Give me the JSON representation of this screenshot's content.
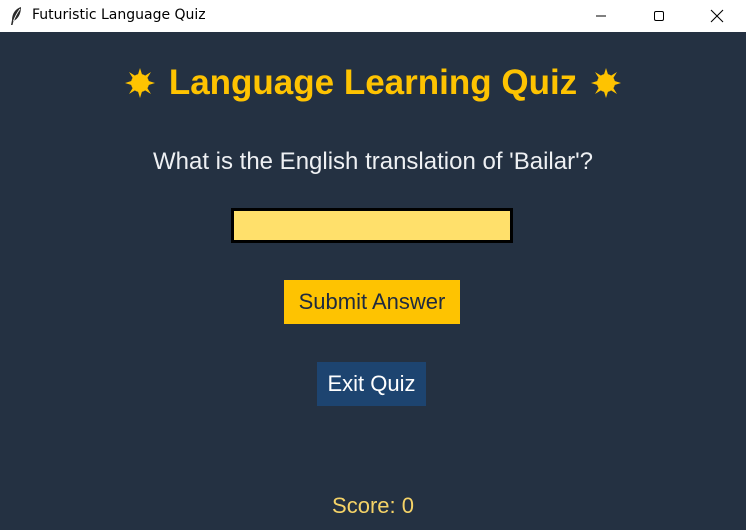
{
  "window": {
    "title": "Futuristic Language Quiz",
    "icon": "feather-icon",
    "controls": [
      "minimize-icon",
      "maximize-icon",
      "close-icon"
    ]
  },
  "quiz": {
    "heading": "Language Learning Quiz",
    "heading_icon": "sparkle-icon",
    "question": "What is the English translation of 'Bailar'?",
    "answer": {
      "value": "",
      "placeholder": ""
    },
    "submit_label": "Submit Answer",
    "exit_label": "Exit Quiz",
    "score_text": "Score: 0"
  },
  "colors": {
    "background": "#243142",
    "accent": "#fec301",
    "input_bg": "#ffe06b",
    "exit_bg": "#1d4470",
    "question_text": "#eef0f3",
    "score_text": "#f5d367"
  }
}
